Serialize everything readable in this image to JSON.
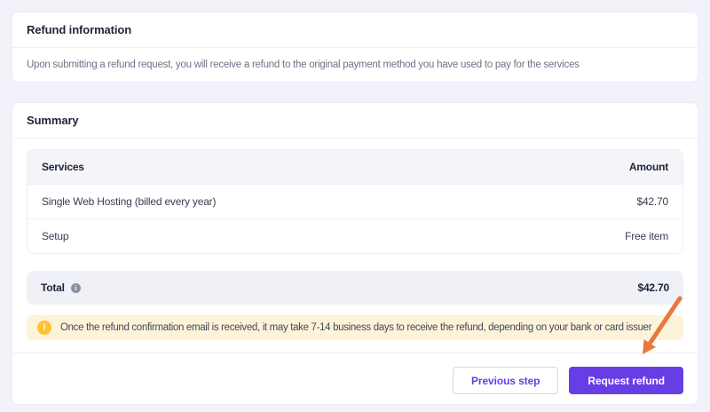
{
  "refund_info_card": {
    "title": "Refund information",
    "description": "Upon submitting a refund request, you will receive a refund to the original payment method you have used to pay for the services"
  },
  "summary_card": {
    "title": "Summary",
    "table": {
      "headers": {
        "service": "Services",
        "amount": "Amount"
      },
      "rows": [
        {
          "service": "Single Web Hosting (billed every year)",
          "amount": "$42.70"
        },
        {
          "service": "Setup",
          "amount": "Free item"
        }
      ]
    },
    "total": {
      "label": "Total",
      "info_icon": "info-circle-icon",
      "info_glyph": "i",
      "amount": "$42.70"
    },
    "notice": {
      "icon": "warning-circle-icon",
      "icon_glyph": "!",
      "text": "Once the refund confirmation email is received, it may take 7-14 business days to receive the refund, depending on your bank or card issuer"
    },
    "actions": {
      "previous_label": "Previous step",
      "request_label": "Request refund"
    }
  },
  "annotation": {
    "type": "arrow",
    "points_to": "request-refund-button",
    "color": "#e8793c"
  },
  "colors": {
    "page_bg": "#f2f3fa",
    "accent_purple": "#673de6",
    "notice_bg": "#fdf3d8",
    "notice_icon": "#fdc233",
    "total_bg": "#eff1f7",
    "table_header_bg": "#f4f5f9",
    "arrow": "#e8793c"
  }
}
